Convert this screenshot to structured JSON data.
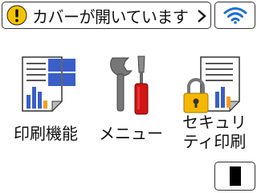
{
  "status": {
    "message": "カバーが開いています",
    "icon": "warning-icon",
    "accent": "#f5c400"
  },
  "menu": [
    {
      "label_lines": [
        "印刷機能"
      ],
      "icon": "print-functions-icon"
    },
    {
      "label_lines": [
        "メニュー"
      ],
      "icon": "tools-icon"
    },
    {
      "label_lines": [
        "セキュリ",
        "ティ印刷"
      ],
      "icon": "secure-print-icon"
    }
  ],
  "wifi": {
    "icon": "wifi-icon",
    "color": "#1f6fd1"
  },
  "toner": {
    "icon": "toner-icon"
  }
}
